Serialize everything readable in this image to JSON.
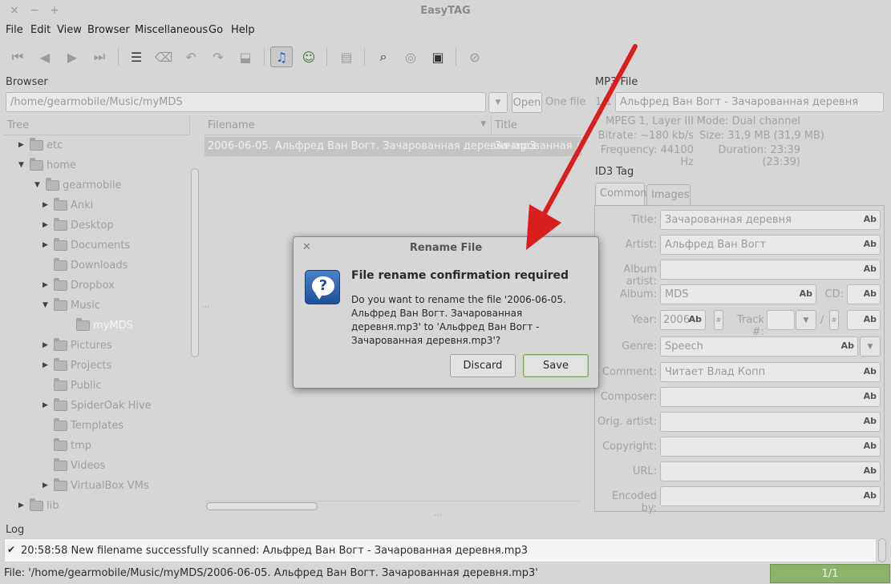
{
  "window": {
    "title": "EasyTAG",
    "close": "×",
    "minimize": "−",
    "maximize": "+"
  },
  "menu": [
    "File",
    "Edit",
    "View",
    "Browser",
    "Miscellaneous",
    "Go",
    "Help"
  ],
  "toolbar": {
    "icons": [
      "go-first-icon",
      "go-previous-icon",
      "go-next-icon",
      "go-last-icon",
      "select-list-icon",
      "clear-icon",
      "undo-icon",
      "redo-icon",
      "save-down-icon",
      "music-note-icon",
      "user-settings-icon",
      "list-view-icon",
      "search-icon",
      "cd-icon",
      "playlist-icon",
      "stop-icon"
    ]
  },
  "browser": {
    "label": "Browser",
    "path": "/home/gearmobile/Music/myMDS",
    "open_button": "Open",
    "one_file": "One file",
    "tree_header": "Tree",
    "tree": [
      {
        "label": "etc",
        "depth": 0,
        "expander": "collapsed"
      },
      {
        "label": "home",
        "depth": 0,
        "expander": "expanded"
      },
      {
        "label": "gearmobile",
        "depth": 1,
        "expander": "expanded"
      },
      {
        "label": "Anki",
        "depth": 2,
        "expander": "collapsed"
      },
      {
        "label": "Desktop",
        "depth": 2,
        "expander": "collapsed"
      },
      {
        "label": "Documents",
        "depth": 2,
        "expander": "collapsed"
      },
      {
        "label": "Downloads",
        "depth": 2,
        "expander": "none"
      },
      {
        "label": "Dropbox",
        "depth": 2,
        "expander": "collapsed"
      },
      {
        "label": "Music",
        "depth": 2,
        "expander": "expanded"
      },
      {
        "label": "myMDS",
        "depth": 3,
        "expander": "none",
        "selected": true
      },
      {
        "label": "Pictures",
        "depth": 2,
        "expander": "collapsed"
      },
      {
        "label": "Projects",
        "depth": 2,
        "expander": "collapsed"
      },
      {
        "label": "Public",
        "depth": 2,
        "expander": "none"
      },
      {
        "label": "SpiderOak Hive",
        "depth": 2,
        "expander": "collapsed"
      },
      {
        "label": "Templates",
        "depth": 2,
        "expander": "none"
      },
      {
        "label": "tmp",
        "depth": 2,
        "expander": "none"
      },
      {
        "label": "Videos",
        "depth": 2,
        "expander": "none"
      },
      {
        "label": "VirtualBox VMs",
        "depth": 2,
        "expander": "collapsed"
      },
      {
        "label": "lib",
        "depth": 0,
        "expander": "collapsed"
      }
    ],
    "columns": {
      "filename": "Filename",
      "title": "Title"
    },
    "files": [
      {
        "filename": "2006-06-05. Альфред Ван Вогт. Зачарованная деревня.mp3",
        "title": "Зачарованная де"
      }
    ]
  },
  "mp3": {
    "label": "MP3 File",
    "index": "1/1",
    "filename": "Альфред Ван Вогт - Зачарованная деревня",
    "info_left": [
      "MPEG 1, Layer III",
      "Bitrate: ~180 kb/s",
      "Frequency: 44100 Hz"
    ],
    "info_right": [
      "Mode: Dual channel",
      "Size: 31,9 MB (31,9 MB)",
      "Duration: 23:39 (23:39)"
    ]
  },
  "id3": {
    "label": "ID3 Tag",
    "tabs": [
      "Common",
      "Images"
    ],
    "fields": {
      "title": {
        "label": "Title:",
        "value": "Зачарованная деревня"
      },
      "artist": {
        "label": "Artist:",
        "value": "Альфред Ван Вогт"
      },
      "album_artist": {
        "label": "Album artist:",
        "value": ""
      },
      "album": {
        "label": "Album:",
        "value": "MDS"
      },
      "cd": {
        "label": "CD:",
        "value": ""
      },
      "year": {
        "label": "Year:",
        "value": "2006"
      },
      "track": {
        "label": "Track #:",
        "value": "",
        "slash": "/"
      },
      "genre": {
        "label": "Genre:",
        "value": "Speech"
      },
      "comment": {
        "label": "Comment:",
        "value": "Читает Влад Копп"
      },
      "composer": {
        "label": "Composer:",
        "value": ""
      },
      "orig_artist": {
        "label": "Orig. artist:",
        "value": ""
      },
      "copyright": {
        "label": "Copyright:",
        "value": ""
      },
      "url": {
        "label": "URL:",
        "value": ""
      },
      "encoded_by": {
        "label": "Encoded by:",
        "value": ""
      }
    },
    "ab": "Ab",
    "hash": "#"
  },
  "log": {
    "label": "Log",
    "entry": "20:58:58  New filename successfully scanned: Альфред Ван Вогт - Зачарованная деревня.mp3"
  },
  "status": {
    "text": "File: '/home/gearmobile/Music/myMDS/2006-06-05. Альфред Ван Вогт. Зачарованная деревня.mp3'",
    "progress": "1/1"
  },
  "dialog": {
    "title": "Rename File",
    "heading": "File rename confirmation required",
    "message": "Do you want to rename the file '2006-06-05. Альфред Ван Вогт. Зачарованная деревня.mp3' to 'Альфред Ван Вогт - Зачарованная деревня.mp3'?",
    "discard": "Discard",
    "save": "Save"
  },
  "colors": {
    "annotation_arrow": "#d91e1e",
    "progress_fill": "#8bb46a",
    "selected_row": "#c4c4c4"
  }
}
